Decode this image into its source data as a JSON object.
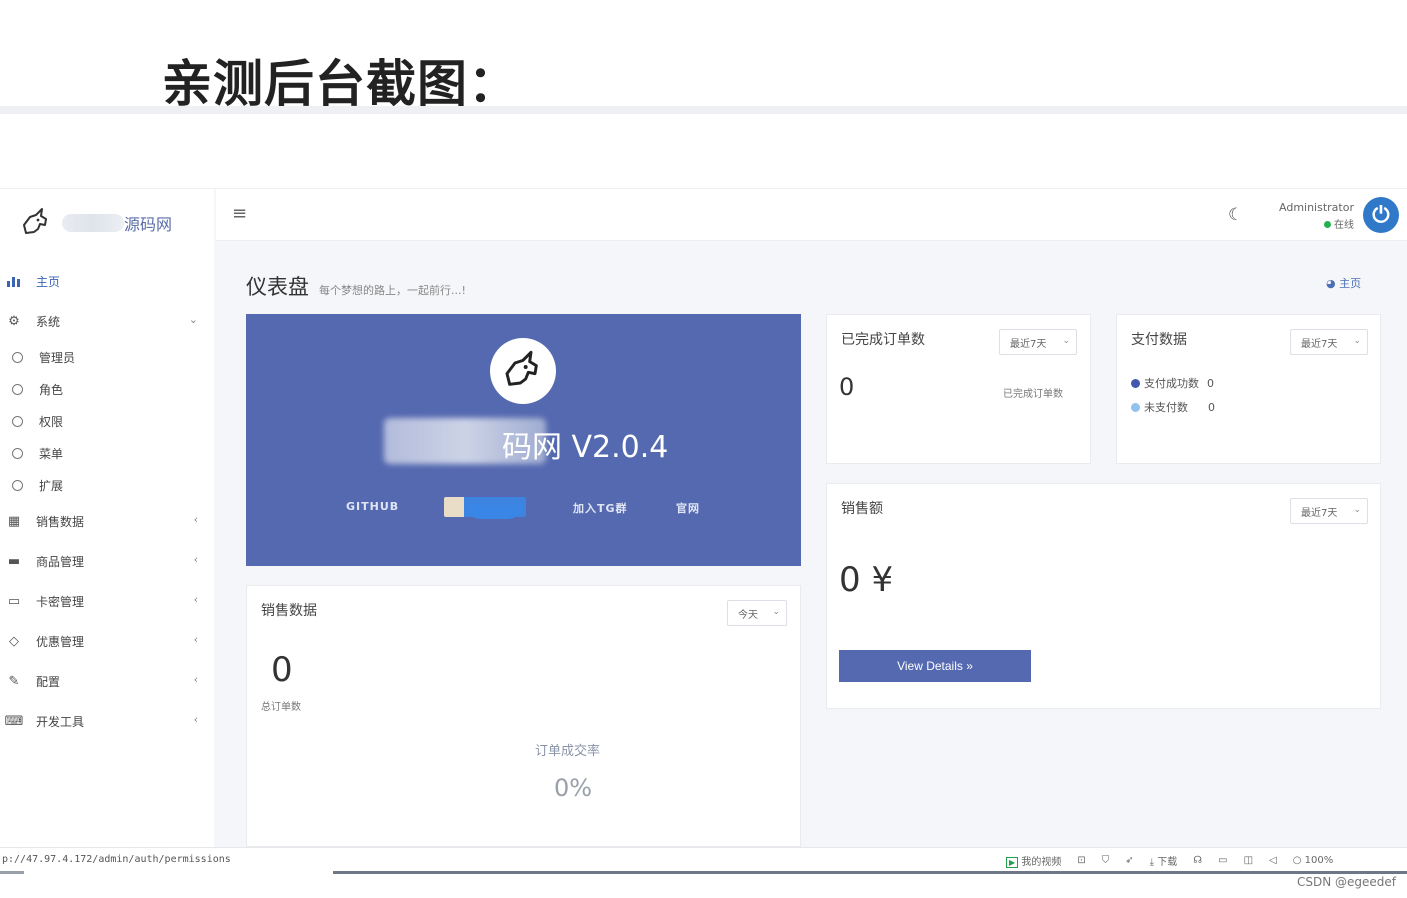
{
  "heading": "亲测后台截图：",
  "brand": {
    "name": "源码网"
  },
  "sidebar": {
    "items": [
      {
        "label": "主页",
        "icon": "bar-chart-icon",
        "active": true
      },
      {
        "label": "系统",
        "icon": "gear-icon",
        "expanded": true,
        "children": [
          "管理员",
          "角色",
          "权限",
          "菜单",
          "扩展"
        ]
      },
      {
        "label": "销售数据",
        "icon": "table-icon"
      },
      {
        "label": "商品管理",
        "icon": "shop-icon"
      },
      {
        "label": "卡密管理",
        "icon": "credit-card-icon"
      },
      {
        "label": "优惠管理",
        "icon": "diamond-icon"
      },
      {
        "label": "配置",
        "icon": "wrench-icon"
      },
      {
        "label": "开发工具",
        "icon": "keyboard-icon"
      }
    ]
  },
  "topbar": {
    "user_name": "Administrator",
    "user_status": "在线"
  },
  "main": {
    "title": "仪表盘",
    "subtitle": "每个梦想的路上，一起前行...!",
    "breadcrumb": "主页",
    "hero": {
      "name": "码网 V2.0.4",
      "links": [
        "GITHUB",
        "加入TG群",
        "官网"
      ]
    },
    "completed_orders": {
      "title": "已完成订单数",
      "period": "最近7天",
      "value": "0",
      "label": "已完成订单数"
    },
    "payment": {
      "title": "支付数据",
      "period": "最近7天",
      "rows": [
        {
          "label": "支付成功数",
          "value": "0",
          "color": "#3f58b0"
        },
        {
          "label": "未支付数",
          "value": "0",
          "color": "#8fc2ee"
        }
      ]
    },
    "sales_amount": {
      "title": "销售额",
      "period": "最近7天",
      "value": "0 ¥",
      "button": "View Details »"
    },
    "sales_data": {
      "title": "销售数据",
      "period": "今天",
      "value": "0",
      "label": "总订单数",
      "rate_label": "订单成交率",
      "rate_value": "0%"
    }
  },
  "statusbar": {
    "url": "p://47.97.4.172/admin/auth/permissions",
    "items": [
      "我的视频",
      "下载",
      "100%"
    ]
  },
  "watermark": "CSDN @egeedef"
}
